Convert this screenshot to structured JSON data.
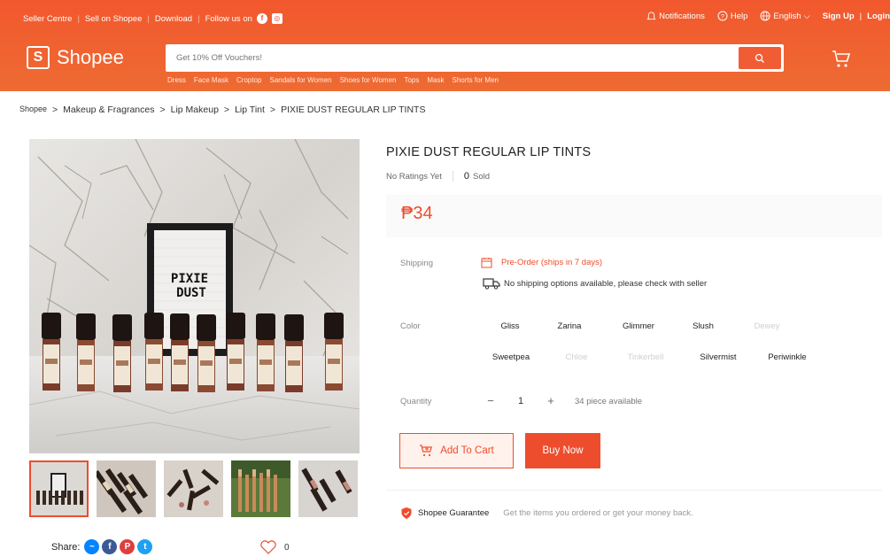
{
  "header": {
    "top_links": [
      "Seller Centre",
      "Sell on Shopee",
      "Download",
      "Follow us on"
    ],
    "notifications": "Notifications",
    "help": "Help",
    "language": "English",
    "signup": "Sign Up",
    "login": "Login",
    "logo_text": "Shopee",
    "search_placeholder": "Get 10% Off Vouchers!",
    "search_hints": [
      "Dress",
      "Face Mask",
      "Croptop",
      "Sandals for Women",
      "Shoes for Women",
      "Tops",
      "Mask",
      "Shorts for Men"
    ]
  },
  "breadcrumb": [
    "Shopee",
    "Makeup & Fragrances",
    "Lip Makeup",
    "Lip Tint",
    "PIXIE DUST REGULAR LIP TINTS"
  ],
  "product": {
    "title": "PIXIE DUST REGULAR LIP TINTS",
    "ratings": "No Ratings Yet",
    "sold_count": "0",
    "sold_label": "Sold",
    "price": "₱34",
    "board_text_1": "PIXIE",
    "board_text_2": "DUST",
    "shipping_label": "Shipping",
    "preorder": "Pre-Order (ships in 7 days)",
    "no_shipping": "No shipping options available, please check with seller",
    "color_label": "Color",
    "colors_row1": [
      {
        "name": "Gliss",
        "disabled": false
      },
      {
        "name": "Zarina",
        "disabled": false
      },
      {
        "name": "Glimmer",
        "disabled": false
      },
      {
        "name": "Slush",
        "disabled": false
      },
      {
        "name": "Dewey",
        "disabled": true
      }
    ],
    "colors_row2": [
      {
        "name": "Sweetpea",
        "disabled": false
      },
      {
        "name": "Chloe",
        "disabled": true
      },
      {
        "name": "Tinkerbell",
        "disabled": true
      },
      {
        "name": "Silvermist",
        "disabled": false
      },
      {
        "name": "Periwinkle",
        "disabled": false
      }
    ],
    "quantity_label": "Quantity",
    "quantity": "1",
    "qty_minus": "−",
    "qty_plus": "+",
    "available": "34 piece available",
    "add_to_cart": "Add To Cart",
    "buy_now": "Buy Now",
    "guarantee": "Shopee Guarantee",
    "guarantee_sub": "Get the items you ordered or get your money back.",
    "share_label": "Share:",
    "favorites": "0"
  },
  "colors": {
    "brand": "#ee4d2d",
    "header_bg": "#f2582e"
  }
}
